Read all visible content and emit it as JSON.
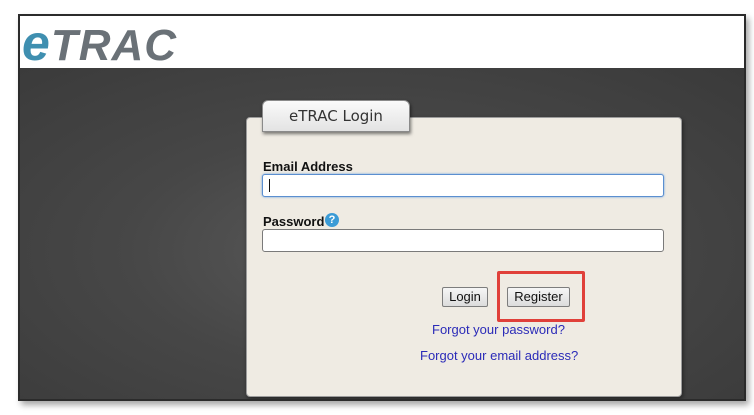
{
  "app": {
    "logo_e": "e",
    "logo_rest": "TRAC"
  },
  "login_panel": {
    "tab_title": "eTRAC Login",
    "email_label": "Email Address",
    "email_value": "",
    "password_label": "Password",
    "password_value": "",
    "help_icon": "?",
    "login_button": "Login",
    "register_button": "Register",
    "forgot_password_link": "Forgot your password?",
    "forgot_email_link": "Forgot your email address?"
  },
  "colors": {
    "highlight": "#e0403a",
    "link": "#2b2bb8",
    "logo_e": "#3f8fb0"
  }
}
